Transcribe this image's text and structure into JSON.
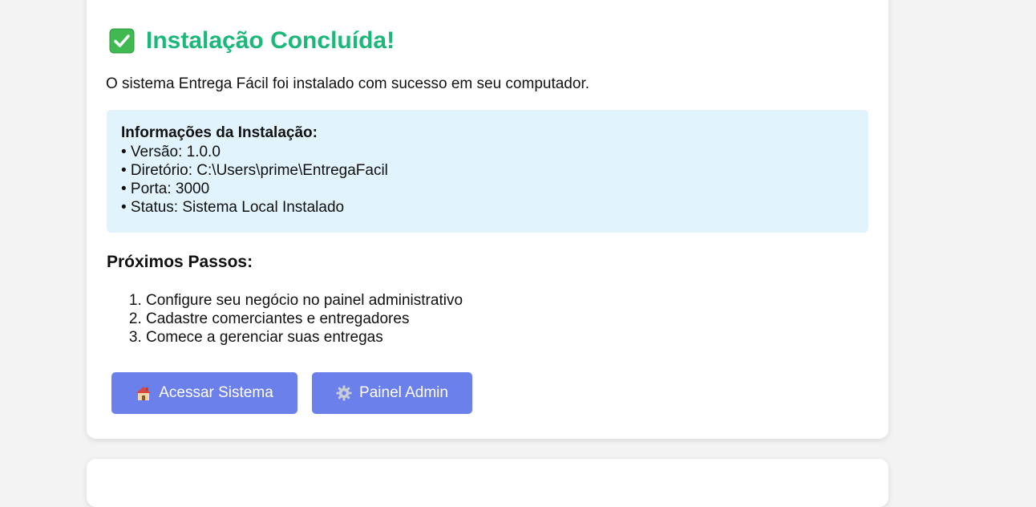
{
  "header": {
    "icon": "check-mark-icon",
    "title": "Instalação Concluída!",
    "title_color": "#1cb87a"
  },
  "subtitle": "O sistema Entrega Fácil foi instalado com sucesso em seu computador.",
  "info": {
    "heading": "Informações da Instalação:",
    "lines": [
      "• Versão: 1.0.0",
      "• Diretório: C:\\Users\\prime\\EntregaFacil",
      "• Porta: 3000",
      "• Status: Sistema Local Instalado"
    ],
    "background": "#e1f3fc"
  },
  "next_steps": {
    "heading": "Próximos Passos:",
    "items": [
      "Configure seu negócio no painel administrativo",
      "Cadastre comerciantes e entregadores",
      "Comece a gerenciar suas entregas"
    ]
  },
  "buttons": {
    "access": {
      "label": "Acessar Sistema",
      "icon": "house-icon"
    },
    "admin": {
      "label": "Painel Admin",
      "icon": "gear-icon"
    },
    "color": "#6b80ea"
  }
}
